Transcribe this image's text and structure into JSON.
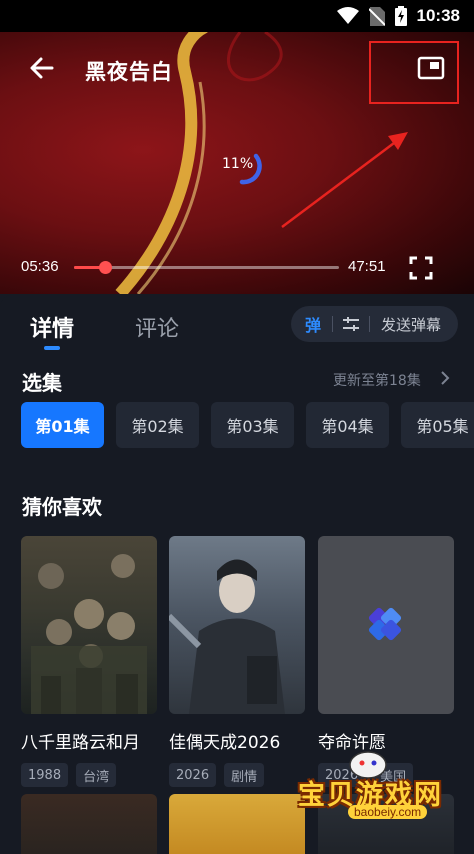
{
  "status_bar": {
    "time": "10:38",
    "icons": [
      "wifi-icon",
      "no-sim-icon",
      "battery-charging-icon"
    ]
  },
  "player": {
    "title": "黑夜告白",
    "loading_percent": "11%",
    "current_time": "05:36",
    "total_time": "47:51",
    "progress_fraction": 0.117,
    "icons": [
      "back-arrow-icon",
      "picture-in-picture-icon",
      "fullscreen-icon"
    ],
    "highlight_color": "#e8231f"
  },
  "tabs": {
    "details": "详情",
    "comments": "评论"
  },
  "danmu": {
    "toggle_label": "弹",
    "send_label": "发送弹幕"
  },
  "episodes": {
    "title": "选集",
    "update_text": "更新至第18集",
    "items": [
      "第01集",
      "第02集",
      "第03集",
      "第04集",
      "第05集"
    ],
    "active_index": 0
  },
  "recommend": {
    "title": "猜你喜欢",
    "items": [
      {
        "name": "八千里路云和月",
        "year": "1988",
        "region": "台湾"
      },
      {
        "name": "佳偶天成2026",
        "year": "2026",
        "region": "剧情"
      },
      {
        "name": "夺命许愿",
        "year": "2026",
        "region": "美国"
      }
    ]
  },
  "watermark": {
    "text": "宝贝游戏网",
    "url": "baobeiy.com"
  },
  "colors": {
    "accent": "#1677ff",
    "progress": "#ff4a4a",
    "background": "#161a23"
  }
}
